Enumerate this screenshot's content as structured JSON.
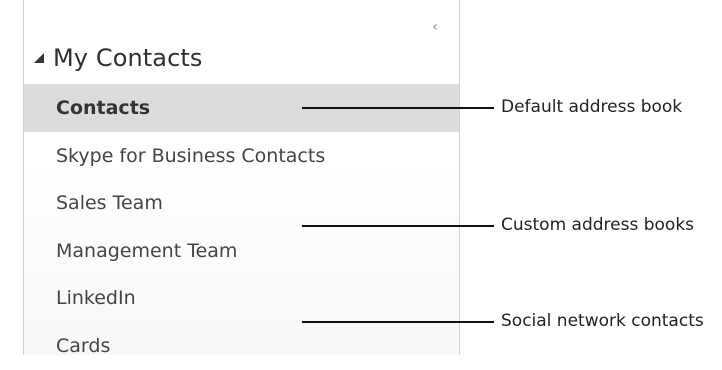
{
  "sidebar": {
    "collapse_glyph": "‹",
    "group": {
      "title": "My Contacts"
    },
    "items": [
      {
        "label": "Contacts",
        "selected": true
      },
      {
        "label": "Skype for Business Contacts",
        "selected": false
      },
      {
        "label": "Sales Team",
        "selected": false
      },
      {
        "label": "Management Team",
        "selected": false
      },
      {
        "label": "LinkedIn",
        "selected": false
      },
      {
        "label": "Cards",
        "selected": false
      }
    ]
  },
  "callouts": {
    "default": "Default address book",
    "custom": "Custom address books",
    "social": "Social network contacts"
  },
  "colors": {
    "selected_background": "#dcdcdc",
    "callout_line": "#111111"
  }
}
